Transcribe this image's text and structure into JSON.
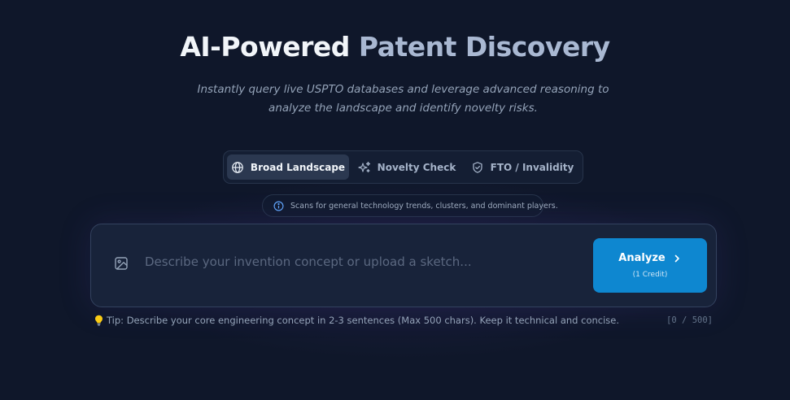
{
  "hero": {
    "title_part1": "AI-Powered",
    "title_part2": "Patent Discovery",
    "subtitle": "Instantly query live USPTO databases and leverage advanced reasoning to analyze the landscape and identify novelty risks."
  },
  "modes": [
    {
      "label": "Broad Landscape",
      "icon": "globe-icon",
      "active": true
    },
    {
      "label": "Novelty Check",
      "icon": "sparkles-icon",
      "active": false
    },
    {
      "label": "FTO / Invalidity",
      "icon": "shield-icon",
      "active": false
    }
  ],
  "mode_hint": {
    "icon": "info-icon",
    "text": "Scans for general technology trends, clusters, and dominant players."
  },
  "input": {
    "placeholder": "Describe your invention concept or upload a sketch...",
    "value": "",
    "upload_icon": "image-icon"
  },
  "analyze_button": {
    "label": "Analyze",
    "credit": "(1 Credit)",
    "icon": "chevron-right-icon"
  },
  "tip": {
    "icon": "lightbulb-icon",
    "text": "Tip: Describe your core engineering concept in 2-3 sentences (Max 500 chars). Keep it technical and concise."
  },
  "char_counter": "[0 / 500]",
  "colors": {
    "background": "#0f172a",
    "accent": "#0e87d0",
    "active_tab": "#2b3850"
  }
}
